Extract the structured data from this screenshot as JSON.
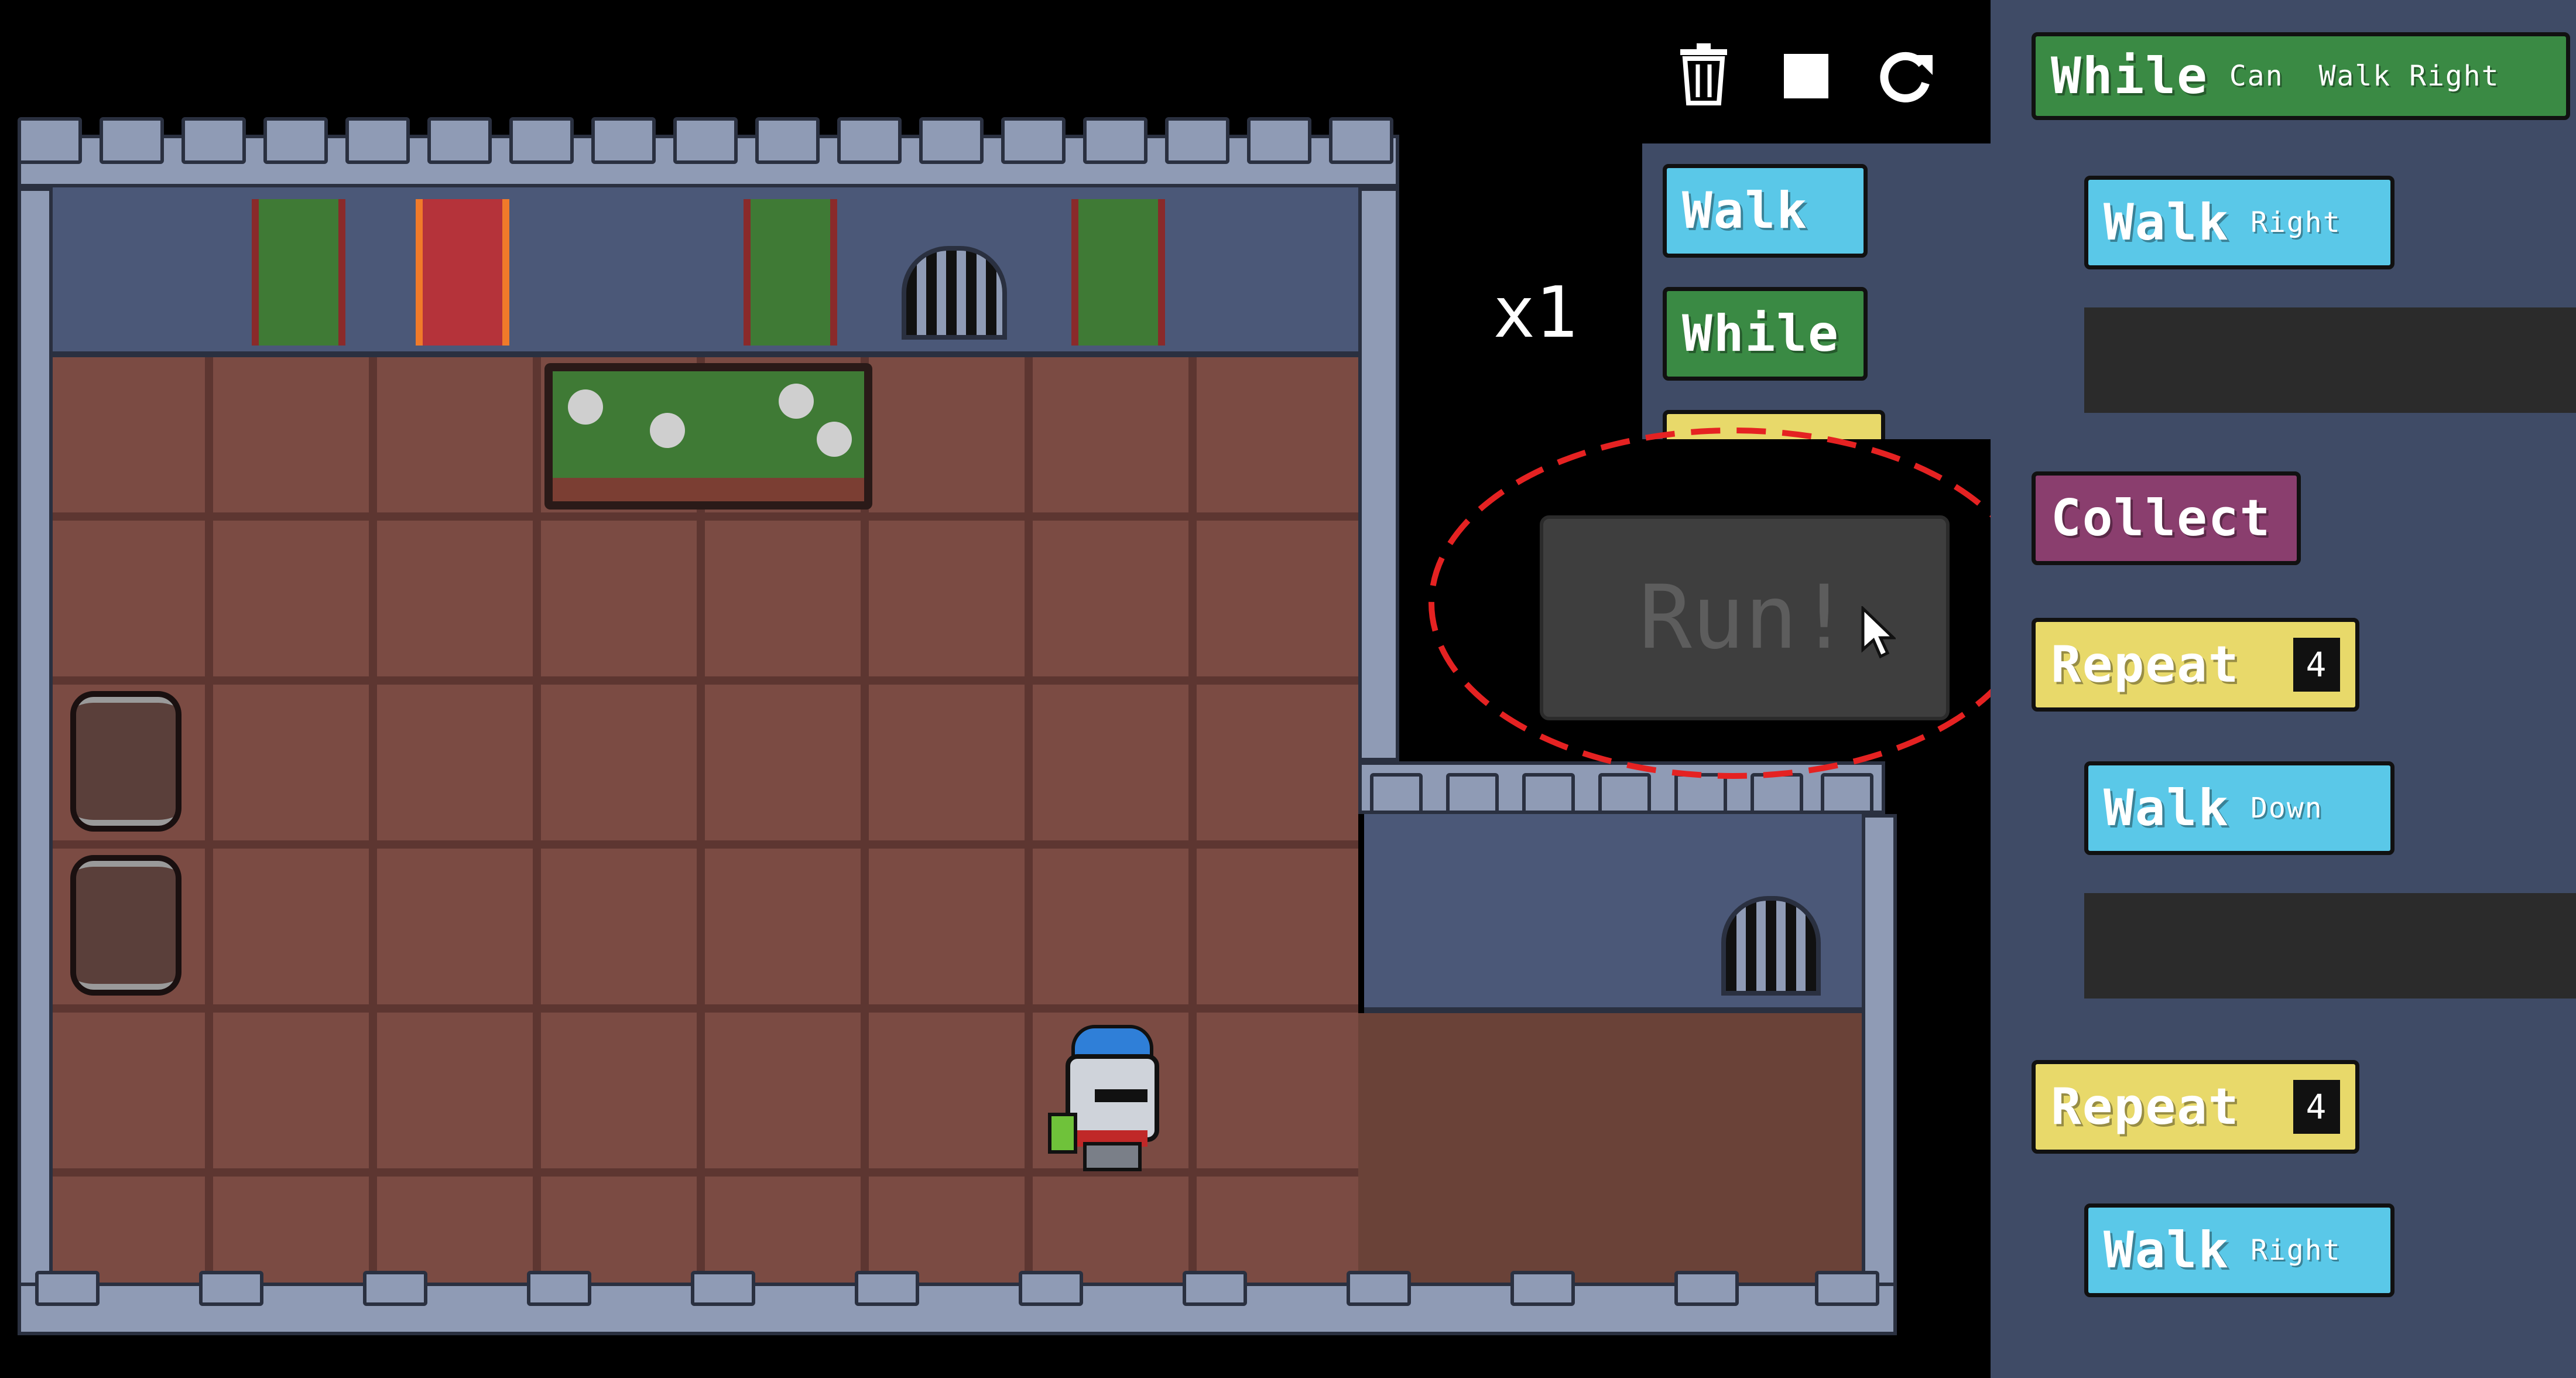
{
  "toolbar": {
    "trash_icon": "trash-icon",
    "stop_icon": "stop-icon",
    "reset_icon": "reset-icon"
  },
  "speed": {
    "label": "x1"
  },
  "palette": {
    "blocks": [
      {
        "label": "Walk"
      },
      {
        "label": "While"
      }
    ]
  },
  "run_button": {
    "label": "Run!"
  },
  "program": {
    "while_block": {
      "label": "While",
      "condition_1": "Can",
      "condition_2": "Walk Right"
    },
    "walk_right_1": {
      "label": "Walk",
      "direction": "Right"
    },
    "collect": {
      "label": "Collect"
    },
    "repeat_1": {
      "label": "Repeat",
      "count": "4"
    },
    "walk_down": {
      "label": "Walk",
      "direction": "Down"
    },
    "repeat_2": {
      "label": "Repeat",
      "count": "4"
    },
    "walk_right_2": {
      "label": "Walk",
      "direction": "Right"
    }
  },
  "colors": {
    "walk_block": "#5ac8e8",
    "while_block": "#3a8a44",
    "collect_block": "#8a3e6e",
    "repeat_block": "#e8d96a",
    "code_panel_bg": "#3f4b66",
    "highlight_ring": "#e52222"
  }
}
